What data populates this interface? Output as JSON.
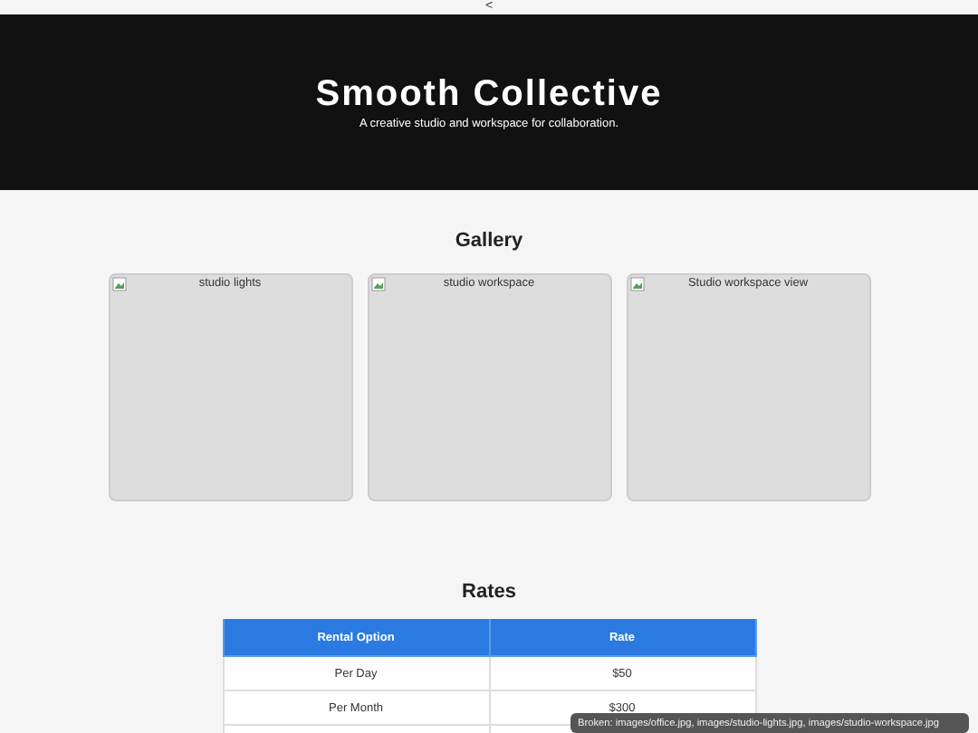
{
  "top_bar": {
    "back": "<"
  },
  "header": {
    "title": "Smooth Collective",
    "tagline": "A creative studio and workspace for collaboration."
  },
  "gallery": {
    "heading": "Gallery",
    "images": [
      {
        "alt": "studio lights"
      },
      {
        "alt": "studio workspace"
      },
      {
        "alt": "Studio workspace view"
      }
    ]
  },
  "rates": {
    "heading": "Rates",
    "columns": [
      "Rental Option",
      "Rate"
    ],
    "rows": [
      [
        "Per Day",
        "$50"
      ],
      [
        "Per Month",
        "$300"
      ]
    ]
  },
  "tooltip": "Broken: images/office.jpg, images/studio-lights.jpg, images/studio-workspace.jpg"
}
